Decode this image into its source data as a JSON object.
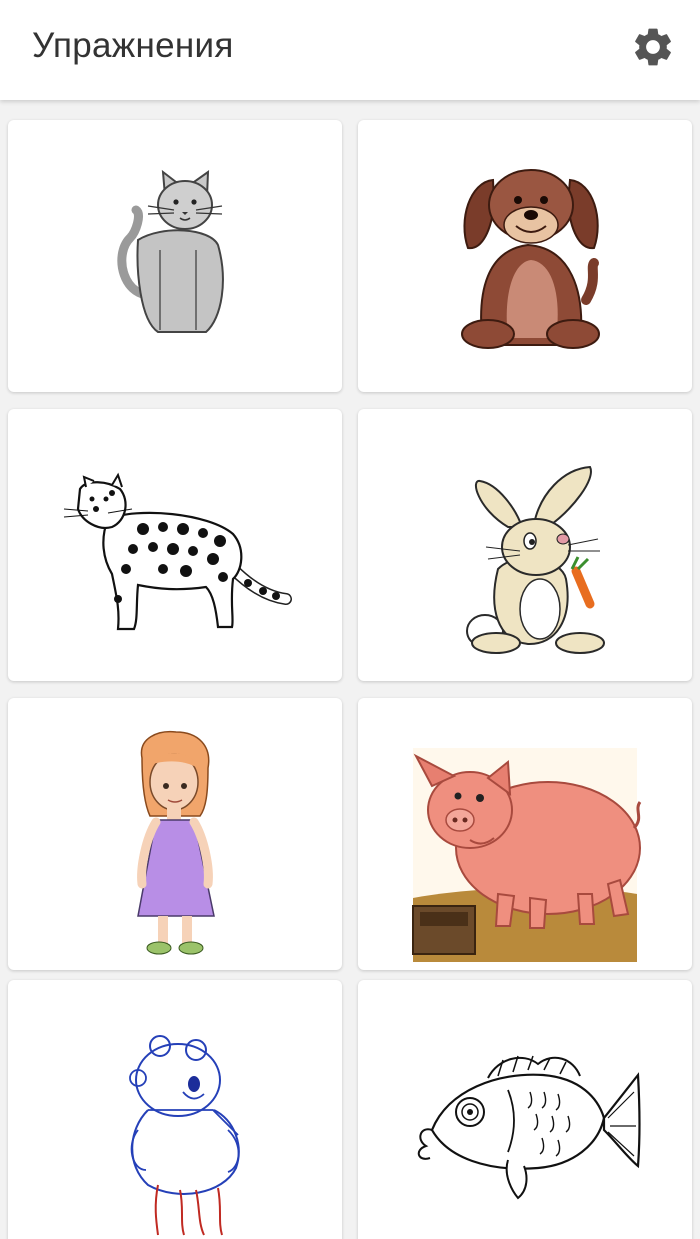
{
  "appbar": {
    "title": "Упражнения",
    "settings_icon": "gear-icon"
  },
  "exercises": [
    {
      "picture": "cat"
    },
    {
      "picture": "puppy"
    },
    {
      "picture": "leopard"
    },
    {
      "picture": "rabbit"
    },
    {
      "picture": "girl"
    },
    {
      "picture": "pig"
    },
    {
      "picture": "bear-sketch"
    },
    {
      "picture": "fish"
    }
  ],
  "colors": {
    "background": "#f2f2f2",
    "card": "#ffffff",
    "title": "#333333",
    "icon": "#555555"
  }
}
